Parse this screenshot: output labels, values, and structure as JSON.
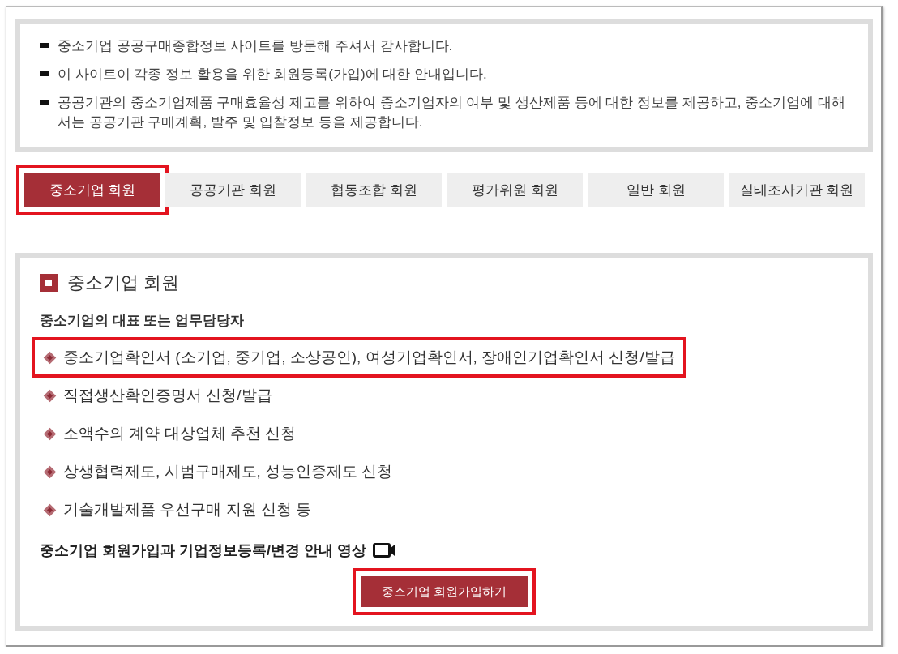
{
  "intro": {
    "items": [
      "중소기업 공공구매종합정보 사이트를 방문해 주셔서 감사합니다.",
      "이 사이트이 각종 정보 활용을 위한 회원등록(가입)에 대한 안내입니다.",
      "공공기관의 중소기업제품 구매효율성 제고를 위하여 중소기업자의 여부 및 생산제품 등에 대한 정보를 제공하고, 중소기업에 대해서는 공공기관 구매계획, 발주 및 입찰정보 등을 제공합니다."
    ]
  },
  "tabs": [
    {
      "label": "중소기업 회원",
      "selected": true,
      "highlighted": true
    },
    {
      "label": "공공기관 회원",
      "selected": false,
      "highlighted": false
    },
    {
      "label": "협동조합 회원",
      "selected": false,
      "highlighted": false
    },
    {
      "label": "평가위원 회원",
      "selected": false,
      "highlighted": false
    },
    {
      "label": "일반 회원",
      "selected": false,
      "highlighted": false
    },
    {
      "label": "실태조사기관 회원",
      "selected": false,
      "highlighted": false
    }
  ],
  "section": {
    "title": "중소기업 회원",
    "subtitle": "중소기업의 대표 또는 업무담당자",
    "items": [
      {
        "text": "중소기업확인서 (소기업, 중기업, 소상공인), 여성기업확인서, 장애인기업확인서 신청/발급",
        "highlighted": true
      },
      {
        "text": "직접생산확인증명서 신청/발급",
        "highlighted": false
      },
      {
        "text": "소액수의 계약 대상업체 추천 신청",
        "highlighted": false
      },
      {
        "text": "상생협력제도, 시범구매제도, 성능인증제도 신청",
        "highlighted": false
      },
      {
        "text": "기술개발제품 우선구매 지원 신청 등",
        "highlighted": false
      }
    ],
    "video_note": "중소기업 회원가입과 기업정보등록/변경 안내 영상",
    "button": {
      "label": "중소기업 회원가입하기",
      "highlighted": true
    }
  }
}
